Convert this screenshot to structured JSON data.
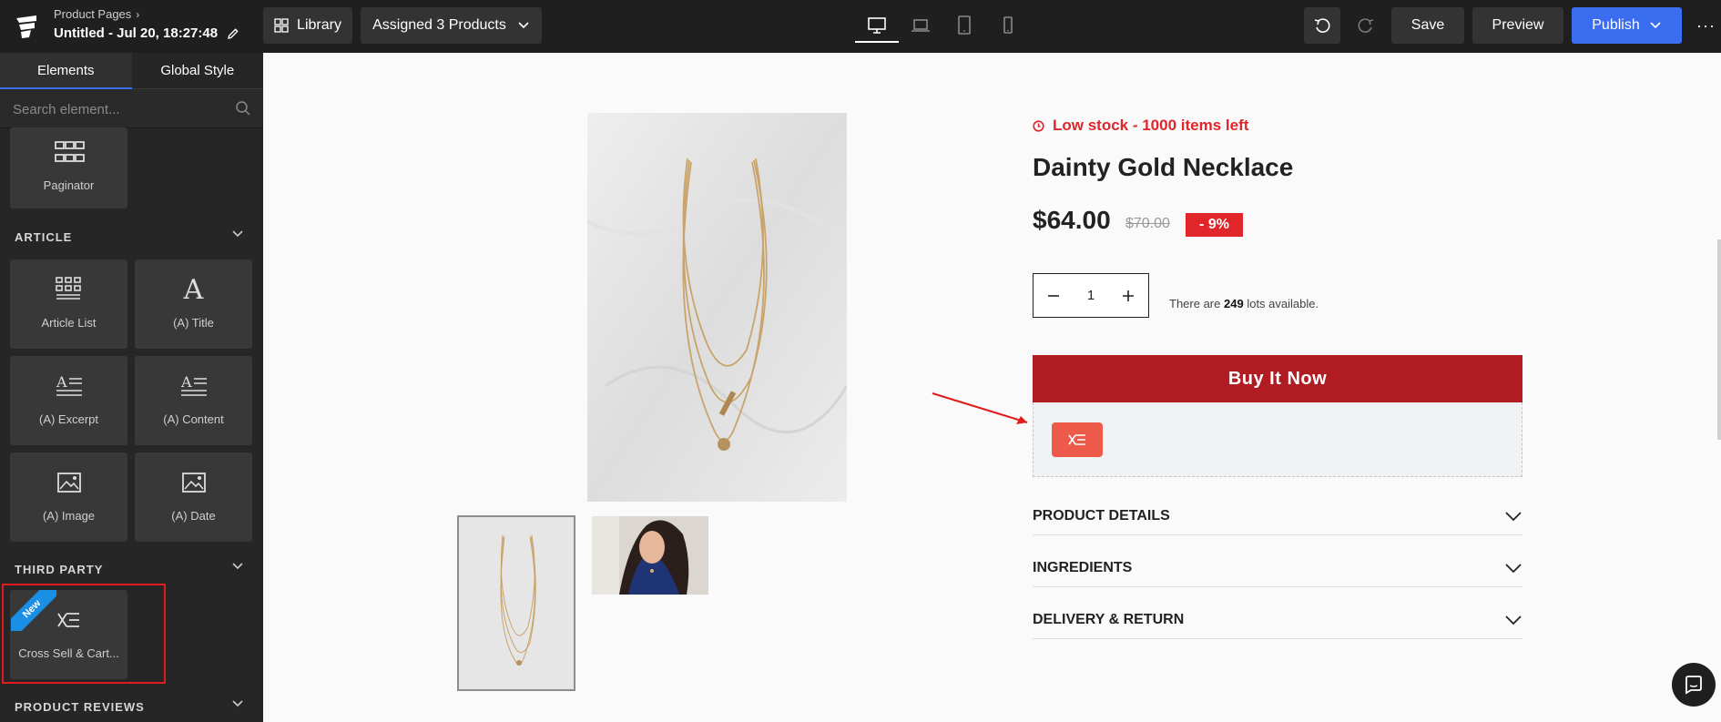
{
  "topbar": {
    "breadcrumb": "Product Pages",
    "doc_title": "Untitled - Jul 20, 18:27:48",
    "library_label": "Library",
    "assigned_label": "Assigned 3 Products",
    "save_label": "Save",
    "preview_label": "Preview",
    "publish_label": "Publish",
    "accent_color": "#3a6df0",
    "devices": [
      "desktop-icon",
      "laptop-icon",
      "tablet-icon",
      "mobile-icon"
    ],
    "active_device": "desktop"
  },
  "sidebar": {
    "tabs": [
      {
        "label": "Elements",
        "active": true
      },
      {
        "label": "Global Style",
        "active": false
      }
    ],
    "search_placeholder": "Search element...",
    "tiles": [
      {
        "label": "Paginator",
        "icon": "paginator-icon"
      },
      {
        "label": "Article List",
        "icon": "article-list-icon"
      },
      {
        "label": "(A) Title",
        "icon": "title-icon"
      },
      {
        "label": "(A) Excerpt",
        "icon": "excerpt-icon"
      },
      {
        "label": "(A) Content",
        "icon": "content-icon"
      },
      {
        "label": "(A) Image",
        "icon": "image-icon"
      },
      {
        "label": "(A) Date",
        "icon": "date-icon"
      },
      {
        "label": "Cross Sell & Cart...",
        "icon": "cross-sell-icon",
        "badge": "New"
      }
    ],
    "sections": {
      "article": "ARTICLE",
      "third_party": "THIRD PARTY",
      "product_reviews": "PRODUCT REVIEWS"
    }
  },
  "product": {
    "stock_text": "Low stock - 1000 items left",
    "title": "Dainty Gold Necklace",
    "price": "$64.00",
    "old_price": "$70.00",
    "discount": "- 9%",
    "quantity": "1",
    "avail_prefix": "There are",
    "avail_count": "249",
    "avail_suffix": "lots available.",
    "buy_label": "Buy It Now",
    "buy_color": "#b01c22",
    "sale_color": "#e0262b",
    "accordions": [
      "PRODUCT DETAILS",
      "INGREDIENTS",
      "DELIVERY & RETURN"
    ]
  }
}
